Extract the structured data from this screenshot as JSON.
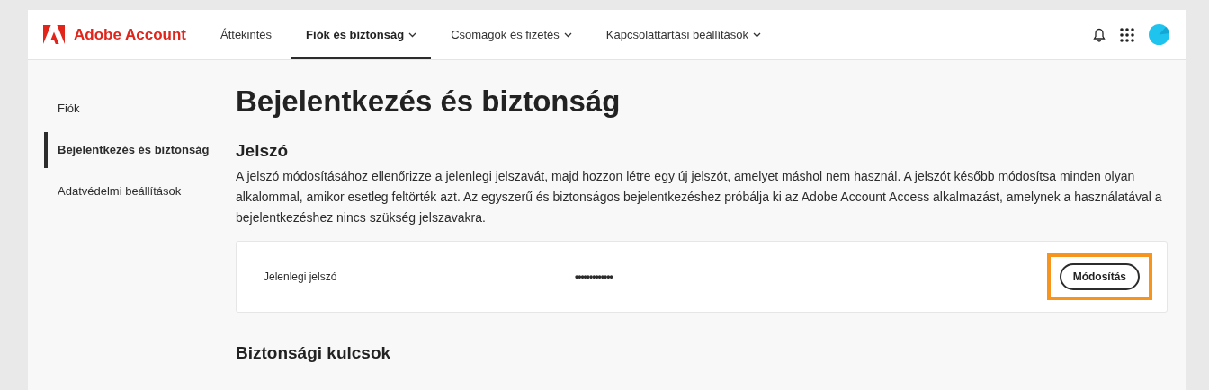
{
  "header": {
    "brand": "Adobe Account",
    "nav": [
      {
        "label": "Áttekintés",
        "selected": false,
        "has_menu": false
      },
      {
        "label": "Fiók és biztonság",
        "selected": true,
        "has_menu": true
      },
      {
        "label": "Csomagok és fizetés",
        "selected": false,
        "has_menu": true
      },
      {
        "label": "Kapcsolattartási beállítások",
        "selected": false,
        "has_menu": true
      }
    ]
  },
  "sidebar": {
    "items": [
      {
        "label": "Fiók",
        "selected": false
      },
      {
        "label": "Bejelentkezés és biztonság",
        "selected": true
      },
      {
        "label": "Adatvédelmi beállítások",
        "selected": false
      }
    ]
  },
  "page_title": "Bejelentkezés és biztonság",
  "password_section": {
    "title": "Jelszó",
    "description": "A jelszó módosításához ellenőrizze a jelenlegi jelszavát, majd hozzon létre egy új jelszót, amelyet máshol nem használ. A jelszót később módosítsa minden olyan alkalommal, amikor esetleg feltörték azt. Az egyszerű és biztonságos bejelentkezéshez próbálja ki az Adobe Account Access alkalmazást, amelynek a használatával a bejelentkezéshez nincs szükség jelszavakra.",
    "row": {
      "label": "Jelenlegi jelszó",
      "value": "•••••••••••••",
      "button": {
        "label": "Módosítás",
        "highlighted": true
      }
    }
  },
  "security_keys_section": {
    "title": "Biztonsági kulcsok"
  }
}
